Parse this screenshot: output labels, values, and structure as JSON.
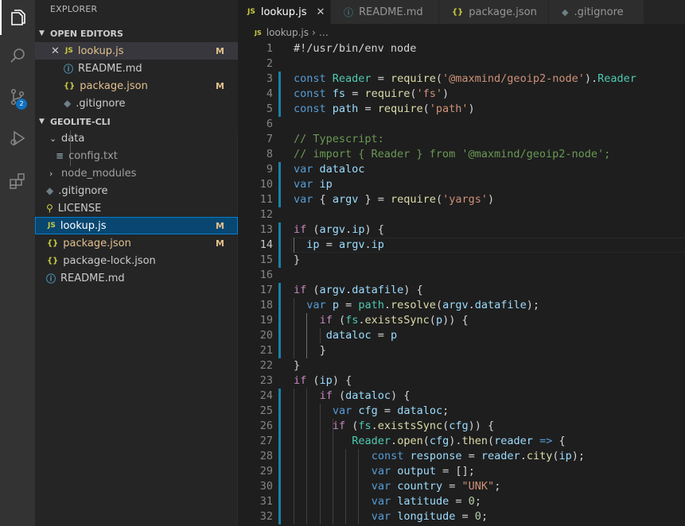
{
  "sidebar": {
    "title": "EXPLORER",
    "open_editors_header": "OPEN EDITORS",
    "project_header": "GEOLITE-CLI",
    "open_editors": [
      {
        "name": "lookup.js",
        "icon": "js",
        "status": "M"
      },
      {
        "name": "README.md",
        "icon": "info",
        "status": ""
      },
      {
        "name": "package.json",
        "icon": "json",
        "status": "M"
      },
      {
        "name": ".gitignore",
        "icon": "dot",
        "status": ""
      }
    ],
    "tree": [
      {
        "name": "data",
        "type": "folder-open"
      },
      {
        "name": "config.txt",
        "type": "file"
      },
      {
        "name": "node_modules",
        "type": "folder"
      },
      {
        "name": ".gitignore",
        "type": "file"
      },
      {
        "name": "LICENSE",
        "type": "file"
      },
      {
        "name": "lookup.js",
        "type": "file",
        "status": "M"
      },
      {
        "name": "package.json",
        "type": "file",
        "status": "M"
      },
      {
        "name": "package-lock.json",
        "type": "file"
      },
      {
        "name": "README.md",
        "type": "file"
      }
    ]
  },
  "activity": {
    "scm_badge": "2"
  },
  "tabs": [
    {
      "label": "lookup.js",
      "icon": "JS",
      "active": true
    },
    {
      "label": "README.md",
      "icon": "ⓘ"
    },
    {
      "label": "package.json",
      "icon": "{}"
    },
    {
      "label": ".gitignore",
      "icon": "◆"
    }
  ],
  "breadcrumb": {
    "icon": "JS",
    "file": "lookup.js",
    "rest": "…"
  },
  "code": {
    "line_numbers": [
      "1",
      "2",
      "3",
      "4",
      "5",
      "6",
      "7",
      "8",
      "9",
      "10",
      "11",
      "12",
      "13",
      "14",
      "15",
      "16",
      "17",
      "18",
      "19",
      "20",
      "21",
      "22",
      "23",
      "24",
      "25",
      "26",
      "27",
      "28",
      "29",
      "30",
      "31",
      "32"
    ],
    "lines": [
      "#!/usr/bin/env node",
      "",
      "const Reader = require('@maxmind/geoip2-node').Reader",
      "const fs = require('fs')",
      "const path = require('path')",
      "",
      "// Typescript:",
      "// import { Reader } from '@maxmind/geoip2-node';",
      "var dataloc",
      "var ip",
      "var { argv } = require('yargs')",
      "",
      "if (argv.ip) {",
      "  ip = argv.ip",
      "}",
      "",
      "if (argv.datafile) {",
      "  var p = path.resolve(argv.datafile);",
      "    if (fs.existsSync(p)) {",
      "     dataloc = p",
      "    }",
      "}",
      "if (ip) {",
      "    if (dataloc) {",
      "      var cfg = dataloc;",
      "      if (fs.existsSync(cfg)) {",
      "         Reader.open(cfg).then(reader => {",
      "            const response = reader.city(ip);",
      "            var output = [];",
      "            var country = \"UNK\";",
      "            var latitude = 0;",
      "            var longitude = 0;"
    ]
  },
  "colors": {
    "keyword": "#569cd6",
    "control": "#c586c0",
    "variable": "#9cdcfe",
    "function": "#dcdcaa",
    "string": "#ce9178",
    "comment": "#6a9955",
    "type": "#4ec9b0",
    "number": "#b5cea8",
    "modified": "#e2c08d",
    "git_bar": "#1b81a8"
  }
}
